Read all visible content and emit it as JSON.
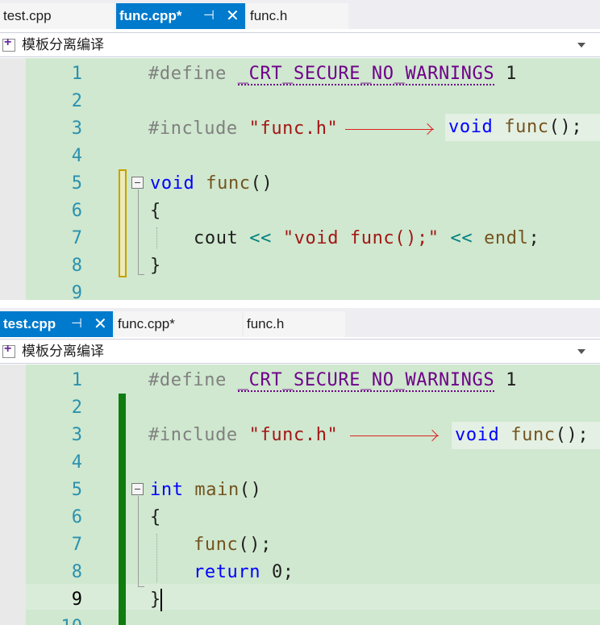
{
  "top_pane": {
    "tabs": [
      {
        "label": "test.cpp",
        "active": false
      },
      {
        "label": "func.cpp*",
        "active": true
      },
      {
        "label": "func.h",
        "active": false
      }
    ],
    "scope_label": "模板分离编译",
    "line_numbers": [
      "1",
      "2",
      "3",
      "4",
      "5",
      "6",
      "7",
      "8",
      "9"
    ],
    "code": {
      "l1_define": "#define",
      "l1_macro": "_CRT_SECURE_NO_WARNINGS",
      "l1_value": "1",
      "l3_include": "#include",
      "l3_header": "\"func.h\"",
      "l5_kw": "void",
      "l5_fn": "func",
      "l5_parens": "()",
      "l6_brace": "{",
      "l7_cout": "cout",
      "l7_op1": "<<",
      "l7_str": "\"void func();\"",
      "l7_op2": "<<",
      "l7_endl": "endl",
      "l7_semi": ";",
      "l8_brace": "}"
    },
    "callout": {
      "kw": "void",
      "fn": "func",
      "rest": "();"
    },
    "change_bar_color": "#c8a000"
  },
  "bottom_pane": {
    "tabs": [
      {
        "label": "test.cpp",
        "active": true
      },
      {
        "label": "func.cpp*",
        "active": false
      },
      {
        "label": "func.h",
        "active": false
      }
    ],
    "scope_label": "模板分离编译",
    "line_numbers": [
      "1",
      "2",
      "3",
      "4",
      "5",
      "6",
      "7",
      "8",
      "9",
      "10"
    ],
    "current_line": "9",
    "code": {
      "l1_define": "#define",
      "l1_macro": "_CRT_SECURE_NO_WARNINGS",
      "l1_value": "1",
      "l3_include": "#include",
      "l3_header": "\"func.h\"",
      "l5_kw": "int",
      "l5_fn": "main",
      "l5_parens": "()",
      "l6_brace": "{",
      "l7_fn": "func",
      "l7_rest": "();",
      "l8_kw": "return",
      "l8_rest": "0;",
      "l9_brace": "}"
    },
    "callout": {
      "kw": "void",
      "fn": "func",
      "rest": "();"
    },
    "change_bar_color": "#107c10"
  },
  "colors": {
    "tab_active": "#007acc",
    "code_background": "#cfe8cf",
    "keyword": "#0000ff",
    "string": "#a31515",
    "function": "#74531f",
    "arrow": "#dd2222"
  },
  "icons": [
    "tab-pin-icon",
    "tab-close-icon",
    "scope-icon",
    "dropdown-arrow-icon",
    "fold-collapse-icon"
  ]
}
